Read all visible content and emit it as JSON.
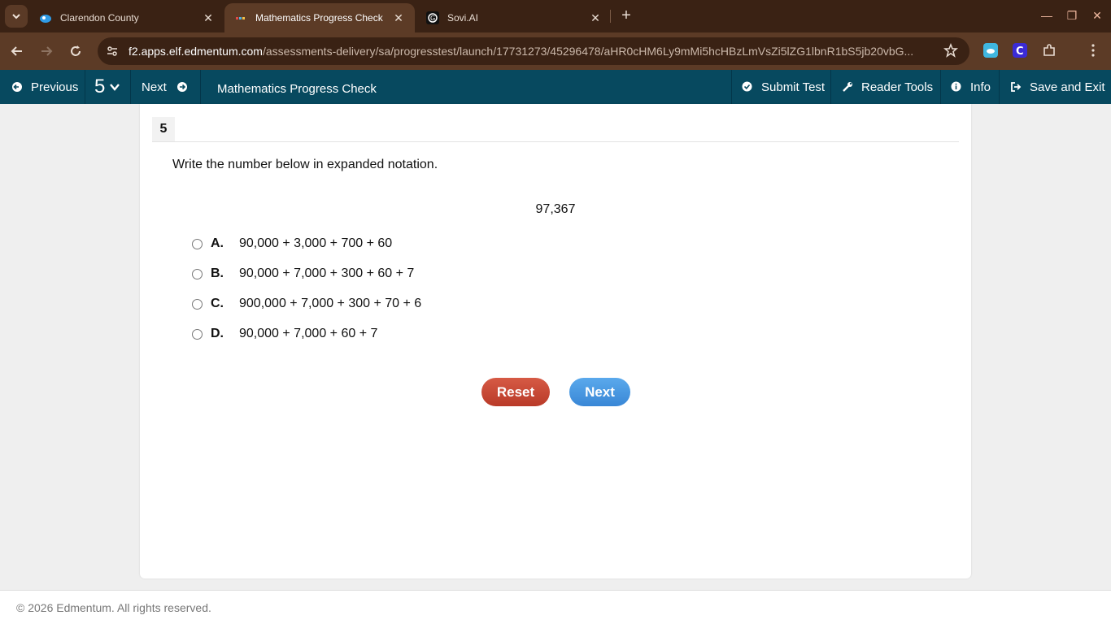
{
  "browser": {
    "tabs": [
      {
        "title": "Clarendon County",
        "active": false
      },
      {
        "title": "Mathematics Progress Check",
        "active": true
      },
      {
        "title": "Sovi.AI",
        "active": false
      }
    ],
    "address": {
      "host": "f2.apps.elf.edmentum.com",
      "path": "/assessments-delivery/sa/progresstest/launch/17731273/45296478/aHR0cHM6Ly9mMi5hcHBzLmVsZi5lZG1lbnR1bS5jb20vbG..."
    },
    "colors": {
      "frame": "#3a2214",
      "toolbar": "#5c3b26"
    }
  },
  "appbar": {
    "previous_label": "Previous",
    "question_number": "5",
    "next_label": "Next",
    "title": "Mathematics Progress Check",
    "submit_label": "Submit Test",
    "reader_tools_label": "Reader Tools",
    "info_label": "Info",
    "save_exit_label": "Save and Exit",
    "color": "#07495f"
  },
  "question": {
    "number": "5",
    "prompt": "Write the number below in expanded notation.",
    "value": "97,367",
    "choices": [
      {
        "letter": "A.",
        "text": "90,000 + 3,000 + 700 + 60"
      },
      {
        "letter": "B.",
        "text": "90,000 + 7,000 + 300 + 60 + 7"
      },
      {
        "letter": "C.",
        "text": "900,000 + 7,000 + 300 + 70 + 6"
      },
      {
        "letter": "D.",
        "text": "90,000 + 7,000 + 60 + 7"
      }
    ],
    "reset_label": "Reset",
    "next_label": "Next"
  },
  "footer": {
    "copyright": "© 2026 Edmentum. All rights reserved."
  }
}
